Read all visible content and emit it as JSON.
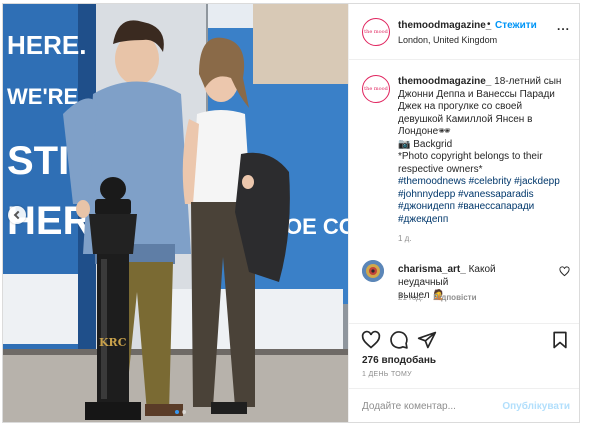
{
  "post": {
    "username": "themoodmagazine_",
    "separator": "•",
    "follow_label": "Стежити",
    "location": "London, United Kingdom",
    "more_label": "...",
    "avatar_text": "the mood"
  },
  "photo": {
    "billboard_text": [
      "HERE.",
      "WE'RE",
      "STILL",
      "HERE"
    ],
    "billboard_right": [
      "OE CO"
    ],
    "post_crest": "KRC",
    "image_description_icon": "prev-arrow-icon",
    "slide_count": 2,
    "active_slide": 1
  },
  "caption": {
    "username": "themoodmagazine_",
    "text_lines": [
      "18-летний сын",
      "Джонни Деппа и Ванессы Паради",
      "Джек на прогулке со своей",
      "девушкой Камиллой Янсен в",
      "Лондоне🕶",
      "📷 Backgrid",
      "*Photo copyright belongs to their",
      "respective owners*"
    ],
    "hashtags": [
      "#themoodnews #celebrity #jackdepp",
      "#johnnydepp #vanessaparadis",
      "#джонидепп #ванессапаради",
      "#джекдепп"
    ],
    "time": "1 д."
  },
  "comment": {
    "username": "charisma_art_",
    "text_first": "Какой неудачный",
    "text_second": "вышел 🤦",
    "time": "21 год.",
    "reply_label": "Відповісти"
  },
  "actions": {
    "likes": "276 вподобань",
    "date": "1 ДЕНЬ ТОМУ"
  },
  "add_comment": {
    "placeholder": "Додайте коментар...",
    "publish_label": "Опублікувати"
  },
  "colors": {
    "link": "#0095f6",
    "hashtag": "#00376b",
    "muted": "#8e8e8e",
    "publish_disabled": "#b2dffc",
    "billboard_blue": "#2f6fb5"
  }
}
